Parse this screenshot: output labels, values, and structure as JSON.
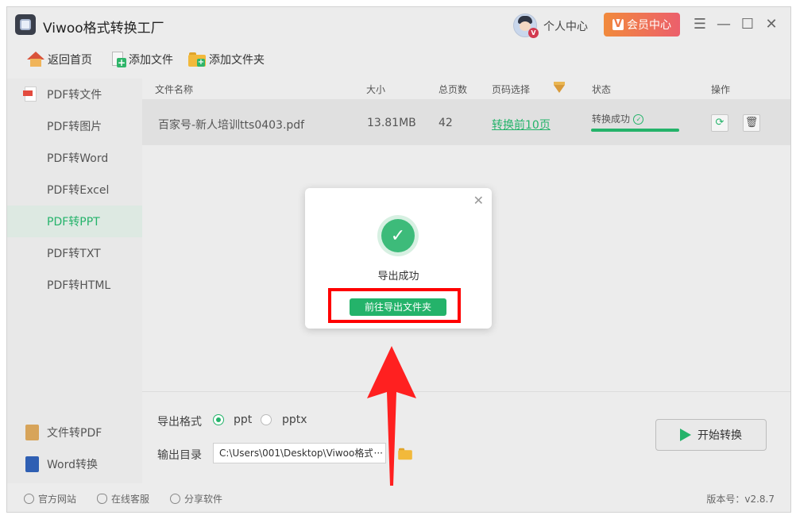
{
  "app": {
    "title": "Viwoo格式转换工厂"
  },
  "header": {
    "user_center": "个人中心",
    "vip": "会员中心",
    "vip_badge": "V",
    "avatar_badge": "V"
  },
  "window_controls": {
    "menu": "☰",
    "minimize": "—",
    "maximize": "☐",
    "close": "✕"
  },
  "toolbar": {
    "home": "返回首页",
    "add_file": "添加文件",
    "add_folder": "添加文件夹"
  },
  "sidebar": {
    "items": [
      {
        "label": "PDF转文件"
      },
      {
        "label": "PDF转图片"
      },
      {
        "label": "PDF转Word"
      },
      {
        "label": "PDF转Excel"
      },
      {
        "label": "PDF转PPT",
        "active": true
      },
      {
        "label": "PDF转TXT"
      },
      {
        "label": "PDF转HTML"
      }
    ],
    "bottom_items": [
      {
        "label": "文件转PDF"
      },
      {
        "label": "Word转换"
      }
    ]
  },
  "table": {
    "headers": {
      "name": "文件名称",
      "size": "大小",
      "pages": "总页数",
      "page_select": "页码选择",
      "status": "状态",
      "actions": "操作"
    },
    "rows": [
      {
        "name": "百家号-新人培训tts0403.pdf",
        "size": "13.81MB",
        "pages": "42",
        "page_select": "转换前10页",
        "status": "转换成功",
        "progress": 1.0
      }
    ]
  },
  "output": {
    "format_label": "导出格式",
    "formats": [
      {
        "label": "ppt",
        "selected": true
      },
      {
        "label": "pptx",
        "selected": false
      }
    ],
    "dir_label": "输出目录",
    "dir_value": "C:\\Users\\001\\Desktop\\Viwoo格式",
    "dir_more": "···",
    "start": "开始转换"
  },
  "statusbar": {
    "website": "官方网站",
    "support": "在线客服",
    "share": "分享软件",
    "version": "版本号：v2.8.7"
  },
  "modal": {
    "message": "导出成功",
    "button": "前往导出文件夹",
    "close": "✕"
  },
  "colors": {
    "accent": "#24b36a",
    "vip_start": "#f18a3c",
    "vip_end": "#ec5f6c",
    "highlight": "#ff0000"
  }
}
